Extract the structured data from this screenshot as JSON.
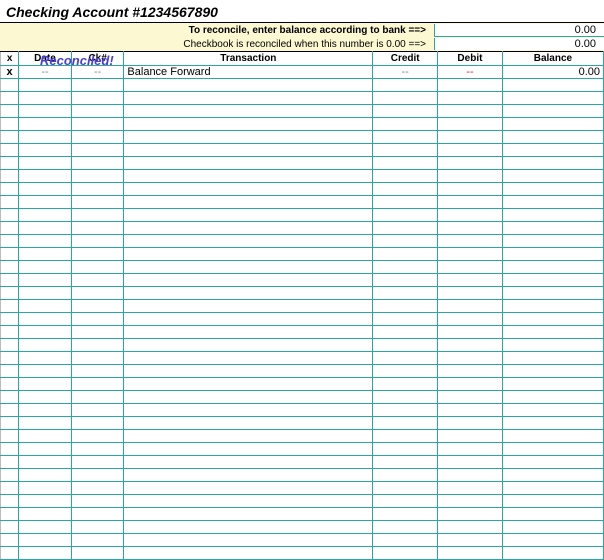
{
  "title": "Checking Account #1234567890",
  "banner": {
    "reconciled_label": "Reconciled!",
    "line1_label": "To reconcile, enter balance according to bank ==>",
    "line1_value": "0.00",
    "line2_label": "Checkbook is reconciled when this number is 0.00 ==>",
    "line2_value": "0.00"
  },
  "headers": {
    "x": "x",
    "date": "Date",
    "ck": "Ck#",
    "transaction": "Transaction",
    "credit": "Credit",
    "debit": "Debit",
    "balance": "Balance"
  },
  "first_row": {
    "x": "x",
    "date": "--",
    "ck": "--",
    "transaction": "Balance Forward",
    "credit": "--",
    "debit": "--",
    "balance": "0.00"
  },
  "empty_row_count": 37
}
